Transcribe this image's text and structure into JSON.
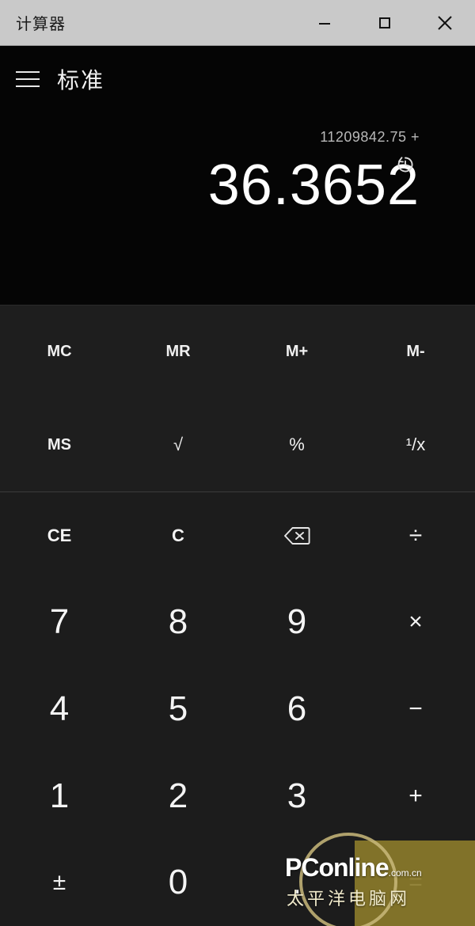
{
  "window": {
    "title": "计算器",
    "controls": [
      {
        "name": "minimize",
        "label": "—"
      },
      {
        "name": "maximize",
        "label": "□"
      },
      {
        "name": "close",
        "label": "✕"
      }
    ]
  },
  "mode": {
    "menu_icon": "hamburger-icon",
    "label": "标准"
  },
  "display": {
    "expression": "11209842.75 +",
    "result": "36.3652",
    "history_icon": "history-icon"
  },
  "memory": {
    "keys": [
      {
        "label": "MC",
        "name": "memory-clear"
      },
      {
        "label": "MR",
        "name": "memory-recall"
      },
      {
        "label": "M+",
        "name": "memory-add"
      },
      {
        "label": "M-",
        "name": "memory-subtract"
      },
      {
        "label": "MS",
        "name": "memory-store"
      },
      {
        "label": "√",
        "name": "square-root"
      },
      {
        "label": "%",
        "name": "percent"
      },
      {
        "label": "¹/x",
        "name": "reciprocal"
      }
    ]
  },
  "keypad": {
    "keys": [
      {
        "label": "CE",
        "name": "clear-entry"
      },
      {
        "label": "C",
        "name": "clear"
      },
      {
        "label": "⌫",
        "name": "backspace"
      },
      {
        "label": "÷",
        "name": "divide"
      },
      {
        "label": "7",
        "name": "digit-7"
      },
      {
        "label": "8",
        "name": "digit-8"
      },
      {
        "label": "9",
        "name": "digit-9"
      },
      {
        "label": "×",
        "name": "multiply"
      },
      {
        "label": "4",
        "name": "digit-4"
      },
      {
        "label": "5",
        "name": "digit-5"
      },
      {
        "label": "6",
        "name": "digit-6"
      },
      {
        "label": "−",
        "name": "subtract"
      },
      {
        "label": "1",
        "name": "digit-1"
      },
      {
        "label": "2",
        "name": "digit-2"
      },
      {
        "label": "3",
        "name": "digit-3"
      },
      {
        "label": "+",
        "name": "add"
      },
      {
        "label": "±",
        "name": "plus-minus"
      },
      {
        "label": "0",
        "name": "digit-0"
      },
      {
        "label": ".",
        "name": "decimal-point"
      },
      {
        "label": "=",
        "name": "equals"
      }
    ]
  },
  "watermark": {
    "brand": "PConline",
    "brand_suffix": ".com.cn",
    "subtitle": "太平洋电脑网"
  },
  "colors": {
    "titlebar": "#c9c9c9",
    "display_bg": "#050505",
    "memory_bg": "#1e1e1e",
    "keypad_bg": "#1c1c1c",
    "text": "#f4f4f4",
    "watermark_gold": "#8a7a2a"
  }
}
